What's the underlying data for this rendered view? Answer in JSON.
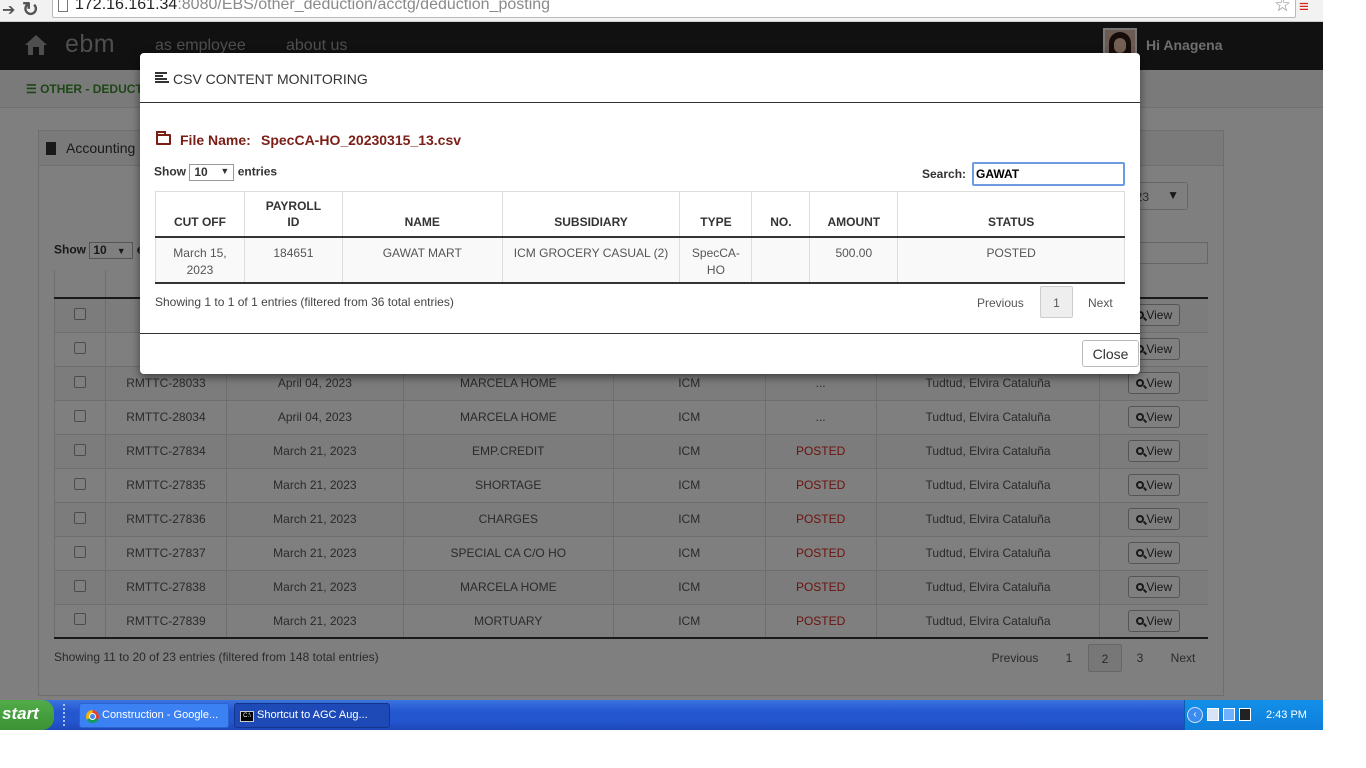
{
  "browser": {
    "url_host": "172.16.161.34",
    "url_rest": ":8080/EBS/other_deduction/acctg/deduction_posting"
  },
  "header": {
    "brand": "ebm",
    "nav": [
      "as employee",
      "about us"
    ],
    "greeting": "Hi Anagena"
  },
  "subbar": {
    "crumb": "OTHER - DEDUCTI"
  },
  "panel": {
    "title": "Accounting",
    "year_select": "023",
    "show_label": "Show",
    "show_value": "10",
    "show_suffix": "e",
    "action_header": "CTION",
    "rows": [
      {
        "ref": "RM",
        "date": "",
        "name": "",
        "type": "",
        "status": "",
        "posted_by": ""
      },
      {
        "ref": "RM",
        "date": "",
        "name": "",
        "type": "",
        "status": "",
        "posted_by": ""
      },
      {
        "ref": "RMTTC-28033",
        "date": "April 04, 2023",
        "name": "MARCELA HOME",
        "type": "ICM",
        "status": "...",
        "posted_by": "Tudtud, Elvira Cataluña"
      },
      {
        "ref": "RMTTC-28034",
        "date": "April 04, 2023",
        "name": "MARCELA HOME",
        "type": "ICM",
        "status": "...",
        "posted_by": "Tudtud, Elvira Cataluña"
      },
      {
        "ref": "RMTTC-27834",
        "date": "March 21, 2023",
        "name": "EMP.CREDIT",
        "type": "ICM",
        "status": "POSTED",
        "posted_by": "Tudtud, Elvira Cataluña"
      },
      {
        "ref": "RMTTC-27835",
        "date": "March 21, 2023",
        "name": "SHORTAGE",
        "type": "ICM",
        "status": "POSTED",
        "posted_by": "Tudtud, Elvira Cataluña"
      },
      {
        "ref": "RMTTC-27836",
        "date": "March 21, 2023",
        "name": "CHARGES",
        "type": "ICM",
        "status": "POSTED",
        "posted_by": "Tudtud, Elvira Cataluña"
      },
      {
        "ref": "RMTTC-27837",
        "date": "March 21, 2023",
        "name": "SPECIAL CA C/O HO",
        "type": "ICM",
        "status": "POSTED",
        "posted_by": "Tudtud, Elvira Cataluña"
      },
      {
        "ref": "RMTTC-27838",
        "date": "March 21, 2023",
        "name": "MARCELA HOME",
        "type": "ICM",
        "status": "POSTED",
        "posted_by": "Tudtud, Elvira Cataluña"
      },
      {
        "ref": "RMTTC-27839",
        "date": "March 21, 2023",
        "name": "MORTUARY",
        "type": "ICM",
        "status": "POSTED",
        "posted_by": "Tudtud, Elvira Cataluña"
      }
    ],
    "view_label": "View",
    "info": "Showing 11 to 20 of 23 entries (filtered from 148 total entries)",
    "pager": {
      "previous": "Previous",
      "pages": [
        "1",
        "2",
        "3"
      ],
      "active": "2",
      "next": "Next"
    }
  },
  "modal": {
    "title": "CSV CONTENT MONITORING",
    "file_label": "File Name:",
    "file_name": "SpecCA-HO_20230315_13.csv",
    "show_label": "Show",
    "show_value": "10",
    "entries_label": "entries",
    "search_label": "Search:",
    "search_value": "GAWAT",
    "columns": [
      "CUT OFF",
      "PAYROLL ID",
      "NAME",
      "SUBSIDIARY",
      "TYPE",
      "NO.",
      "AMOUNT",
      "STATUS"
    ],
    "rows": [
      {
        "cut_off": "March 15, 2023",
        "payroll_id": "184651",
        "name": "GAWAT MART",
        "subsidiary": "ICM GROCERY CASUAL (2)",
        "type": "SpecCA-HO",
        "no": "",
        "amount": "500.00",
        "status": "POSTED"
      }
    ],
    "info": "Showing 1 to 1 of 1 entries (filtered from 36 total entries)",
    "previous": "Previous",
    "page": "1",
    "next": "Next",
    "close_label": "Close"
  },
  "taskbar": {
    "start": "start",
    "items": [
      "Construction - Google...",
      "Shortcut to AGC Aug..."
    ],
    "clock": "2:43 PM"
  },
  "colors": {
    "navbar": "#222222",
    "posted": "#d9261c",
    "file_name": "#7a1e16",
    "taskbar": "#2456d0",
    "start": "#3a9233"
  }
}
